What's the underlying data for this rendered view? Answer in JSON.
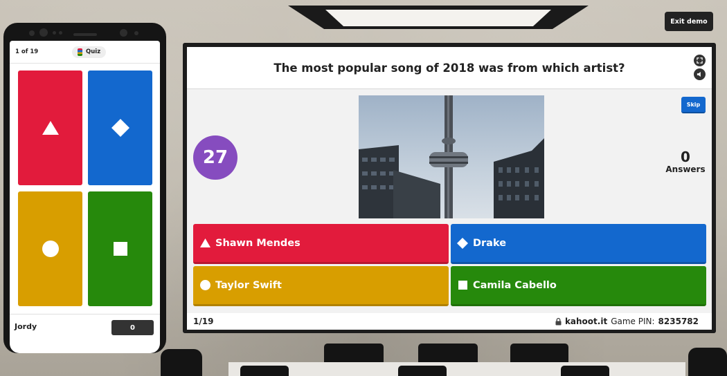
{
  "header": {
    "exit_label": "Exit demo"
  },
  "phone": {
    "progress": "1 of 19",
    "mode_label": "Quiz",
    "player_name": "Jordy",
    "score": "0",
    "tiles": [
      {
        "shape": "triangle-icon",
        "color": "#e21b3c"
      },
      {
        "shape": "diamond-icon",
        "color": "#1368ce"
      },
      {
        "shape": "circle-icon",
        "color": "#d89e00"
      },
      {
        "shape": "square-icon",
        "color": "#26890c"
      }
    ]
  },
  "game": {
    "question": "The most popular song of 2018 was from which artist?",
    "skip_label": "Skip",
    "timer": "27",
    "answers_count": "0",
    "answers_label": "Answers",
    "answers": [
      {
        "text": "Shawn Mendes",
        "shape": "triangle-icon",
        "color": "#e21b3c"
      },
      {
        "text": "Drake",
        "shape": "diamond-icon",
        "color": "#1368ce"
      },
      {
        "text": "Taylor Swift",
        "shape": "circle-icon",
        "color": "#d89e00"
      },
      {
        "text": "Camila Cabello",
        "shape": "square-icon",
        "color": "#26890c"
      }
    ],
    "footer": {
      "progress": "1/19",
      "site": "kahoot.it",
      "pin_label": "Game PIN:",
      "pin": "8235782"
    }
  }
}
